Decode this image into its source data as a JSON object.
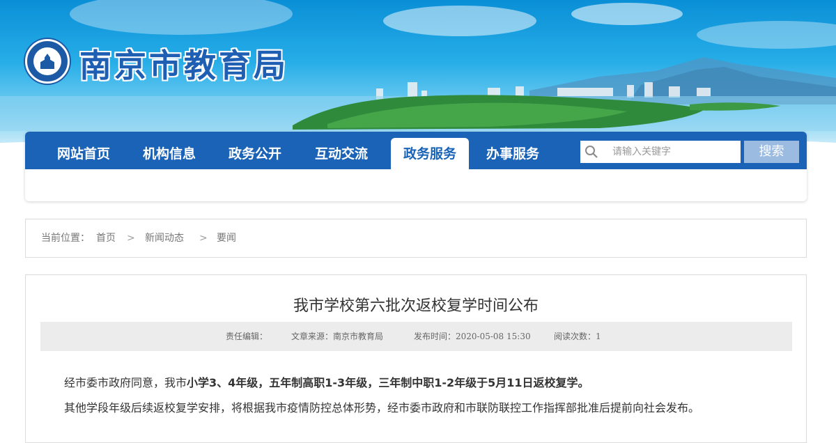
{
  "site": {
    "title": "南京市教育局",
    "logo_icon": "nanjing-education-emblem-icon"
  },
  "nav": {
    "items": [
      {
        "label": "网站首页",
        "active": false
      },
      {
        "label": "机构信息",
        "active": false
      },
      {
        "label": "政务公开",
        "active": false
      },
      {
        "label": "互动交流",
        "active": false
      },
      {
        "label": "政务服务",
        "active": true
      },
      {
        "label": "办事服务",
        "active": false
      }
    ],
    "search_placeholder": "请输入关键字",
    "search_button": "搜索",
    "bar_color": "#1b63b6"
  },
  "breadcrumb": {
    "prefix": "当前位置：",
    "items": [
      "首页",
      "新闻动态",
      "要闻"
    ],
    "separator": ">"
  },
  "article": {
    "title": "我市学校第六批次返校复学时间公布",
    "meta": {
      "editor": "责任编辑：",
      "source": "文章来源：南京市教育局",
      "published": "发布时间：2020-05-08 15:30",
      "views": "阅读次数：1"
    },
    "para1_start": "经市委市政府同意，我市",
    "para1_bold": "小学3、4年级，五年制高职1-3年级，三年制中职1-2年级于5月11日返校复学。",
    "para2": "其他学段年级后续返校复学安排，将根据我市疫情防控总体形势，经市委市政府和市联防联控工作指挥部批准后提前向社会发布。"
  }
}
